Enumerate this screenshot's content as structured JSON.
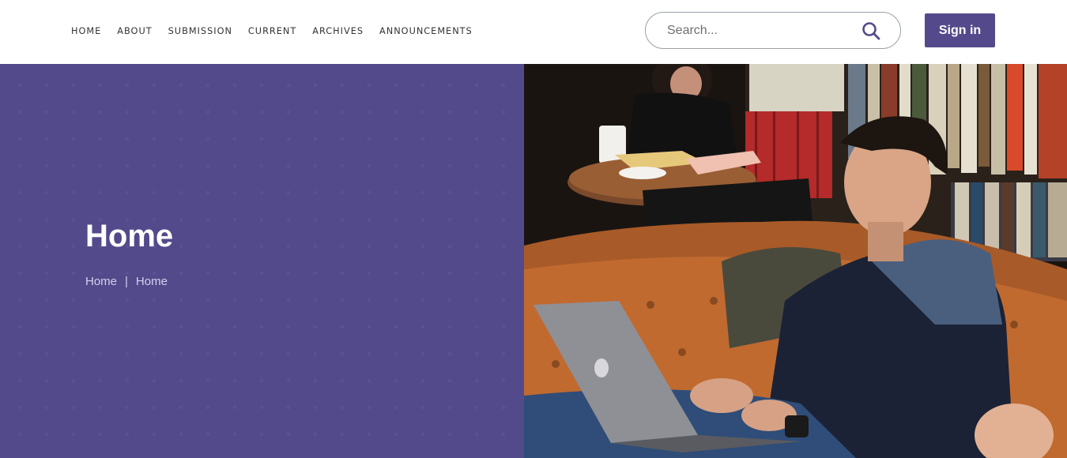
{
  "nav": {
    "items": [
      {
        "label": "HOME"
      },
      {
        "label": "ABOUT"
      },
      {
        "label": "SUBMISSION"
      },
      {
        "label": "CURRENT"
      },
      {
        "label": "ARCHIVES"
      },
      {
        "label": "ANNOUNCEMENTS"
      }
    ]
  },
  "search": {
    "placeholder": "Search...",
    "icon": "search-icon"
  },
  "signin": {
    "label": "Sign in"
  },
  "hero": {
    "title": "Home",
    "breadcrumb": [
      "Home",
      "|",
      "Home"
    ],
    "image": "student-on-couch-with-laptop-photo"
  },
  "colors": {
    "primary": "#544a8b",
    "hero_bg": "#534a8b",
    "breadcrumb_text": "#d4d0ec"
  }
}
